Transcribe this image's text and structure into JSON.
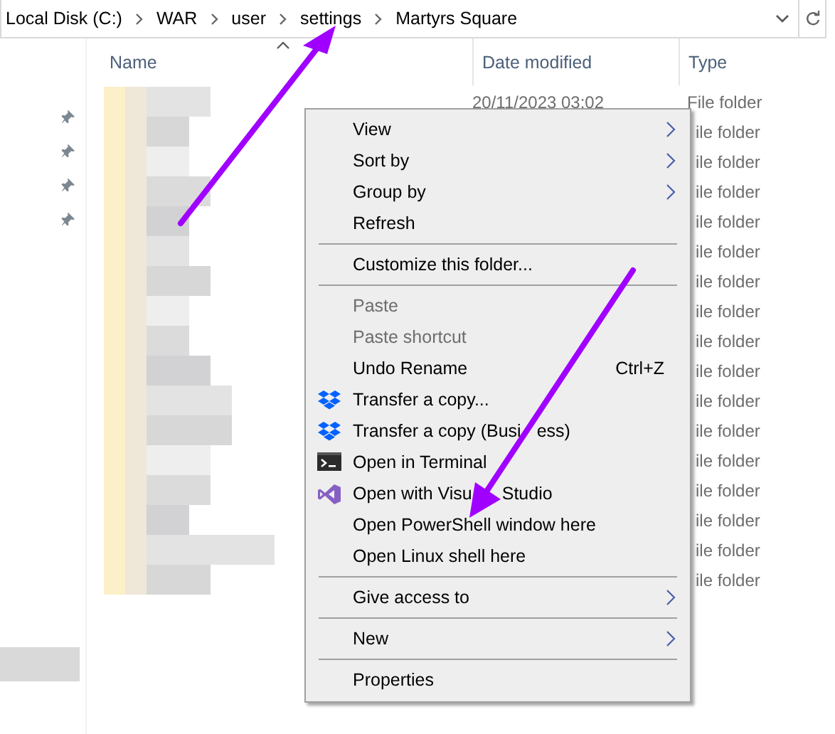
{
  "address_bar": {
    "crumbs": [
      "Local Disk (C:)",
      "WAR",
      "user",
      "settings",
      "Martyrs Square"
    ]
  },
  "columns": [
    {
      "label": "Name",
      "sorted": true
    },
    {
      "label": "Date modified",
      "sorted": false
    },
    {
      "label": "Type",
      "sorted": false
    }
  ],
  "rows": [
    {
      "date_modified": "20/11/2023 03:02",
      "type": "File folder"
    },
    {
      "type": "ile folder"
    },
    {
      "type": "ile folder"
    },
    {
      "type": "ile folder"
    },
    {
      "type": "ile folder"
    },
    {
      "type": "ile folder"
    },
    {
      "type": "ile folder"
    },
    {
      "type": "ile folder"
    },
    {
      "type": "ile folder"
    },
    {
      "type": "ile folder"
    },
    {
      "type": "ile folder"
    },
    {
      "type": "ile folder"
    },
    {
      "type": "ile folder"
    },
    {
      "type": "ile folder"
    },
    {
      "type": "ile folder"
    },
    {
      "type": "ile folder"
    },
    {
      "type": "ile folder"
    }
  ],
  "context_menu": {
    "items": [
      {
        "kind": "command",
        "label": "View",
        "disabled": false,
        "submenu": true
      },
      {
        "kind": "command",
        "label": "Sort by",
        "disabled": false,
        "submenu": true
      },
      {
        "kind": "command",
        "label": "Group by",
        "disabled": false,
        "submenu": true
      },
      {
        "kind": "command",
        "label": "Refresh",
        "disabled": false,
        "submenu": false
      },
      {
        "kind": "separator"
      },
      {
        "kind": "command",
        "label": "Customize this folder...",
        "disabled": false,
        "submenu": false
      },
      {
        "kind": "separator"
      },
      {
        "kind": "command",
        "label": "Paste",
        "disabled": true,
        "submenu": false
      },
      {
        "kind": "command",
        "label": "Paste shortcut",
        "disabled": true,
        "submenu": false
      },
      {
        "kind": "command",
        "label": "Undo Rename",
        "disabled": false,
        "submenu": false,
        "shortcut": "Ctrl+Z"
      },
      {
        "kind": "command",
        "label": "Transfer a copy...",
        "disabled": false,
        "submenu": false
      },
      {
        "kind": "command",
        "label_parts": [
          "Transfer a copy (Busi",
          "ess)"
        ],
        "disabled": false,
        "submenu": false
      },
      {
        "kind": "command",
        "label": "Open in Terminal",
        "disabled": false,
        "submenu": false
      },
      {
        "kind": "command",
        "label_parts": [
          "Open with Visu",
          "Studio"
        ],
        "disabled": false,
        "submenu": false
      },
      {
        "kind": "command",
        "label": "Open PowerShell window here",
        "disabled": false,
        "submenu": false
      },
      {
        "kind": "command",
        "label": "Open Linux shell here",
        "disabled": false,
        "submenu": false
      },
      {
        "kind": "separator"
      },
      {
        "kind": "command",
        "label": "Give access to",
        "disabled": false,
        "submenu": true
      },
      {
        "kind": "separator"
      },
      {
        "kind": "command",
        "label": "New",
        "disabled": false,
        "submenu": true
      },
      {
        "kind": "separator"
      },
      {
        "kind": "command",
        "label": "Properties",
        "disabled": false,
        "submenu": false
      }
    ]
  }
}
